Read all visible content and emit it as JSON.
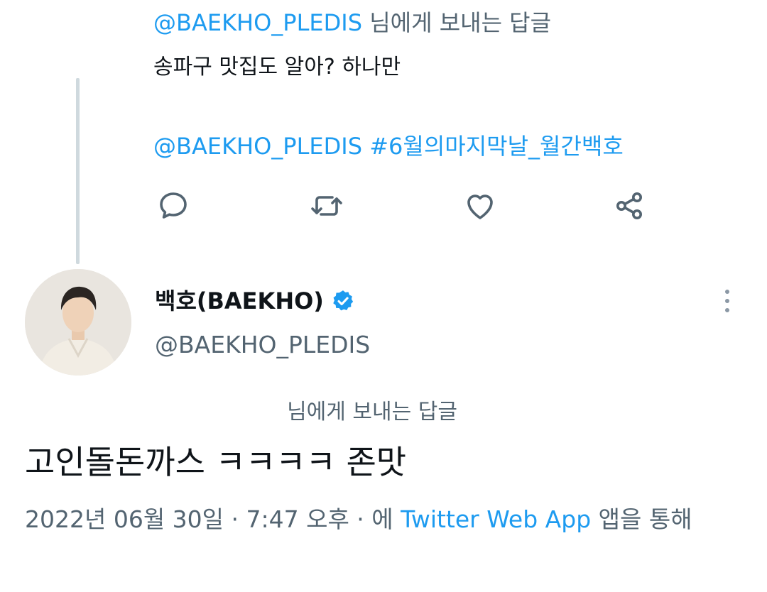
{
  "reply_header": {
    "mention": "@BAEKHO_PLEDIS",
    "suffix": " 님에게 보내는 답글"
  },
  "previous_tweet": {
    "text": "송파구 맛집도 알아? 하나만",
    "mention": "@BAEKHO_PLEDIS",
    "hashtag": " #6월의마지막날_월간백호"
  },
  "actions": {
    "reply": "reply-icon",
    "retweet": "retweet-icon",
    "like": "heart-icon",
    "share": "share-icon"
  },
  "author": {
    "display_name": "백호(BAEKHO)",
    "handle": "@BAEKHO_PLEDIS",
    "verified": true
  },
  "main_tweet": {
    "reply_label": "님에게 보내는 답글",
    "text": "고인돌돈까스 ㅋㅋㅋㅋ 존맛",
    "date": "2022년 06월 30일 · 7:47 오후 · 에 ",
    "source_app": "Twitter Web App",
    "source_suffix": " 앱을 통해"
  },
  "colors": {
    "accent": "#1d9bf0",
    "muted": "#536471",
    "text": "#0f1419",
    "thread_line": "#cfd9de"
  }
}
